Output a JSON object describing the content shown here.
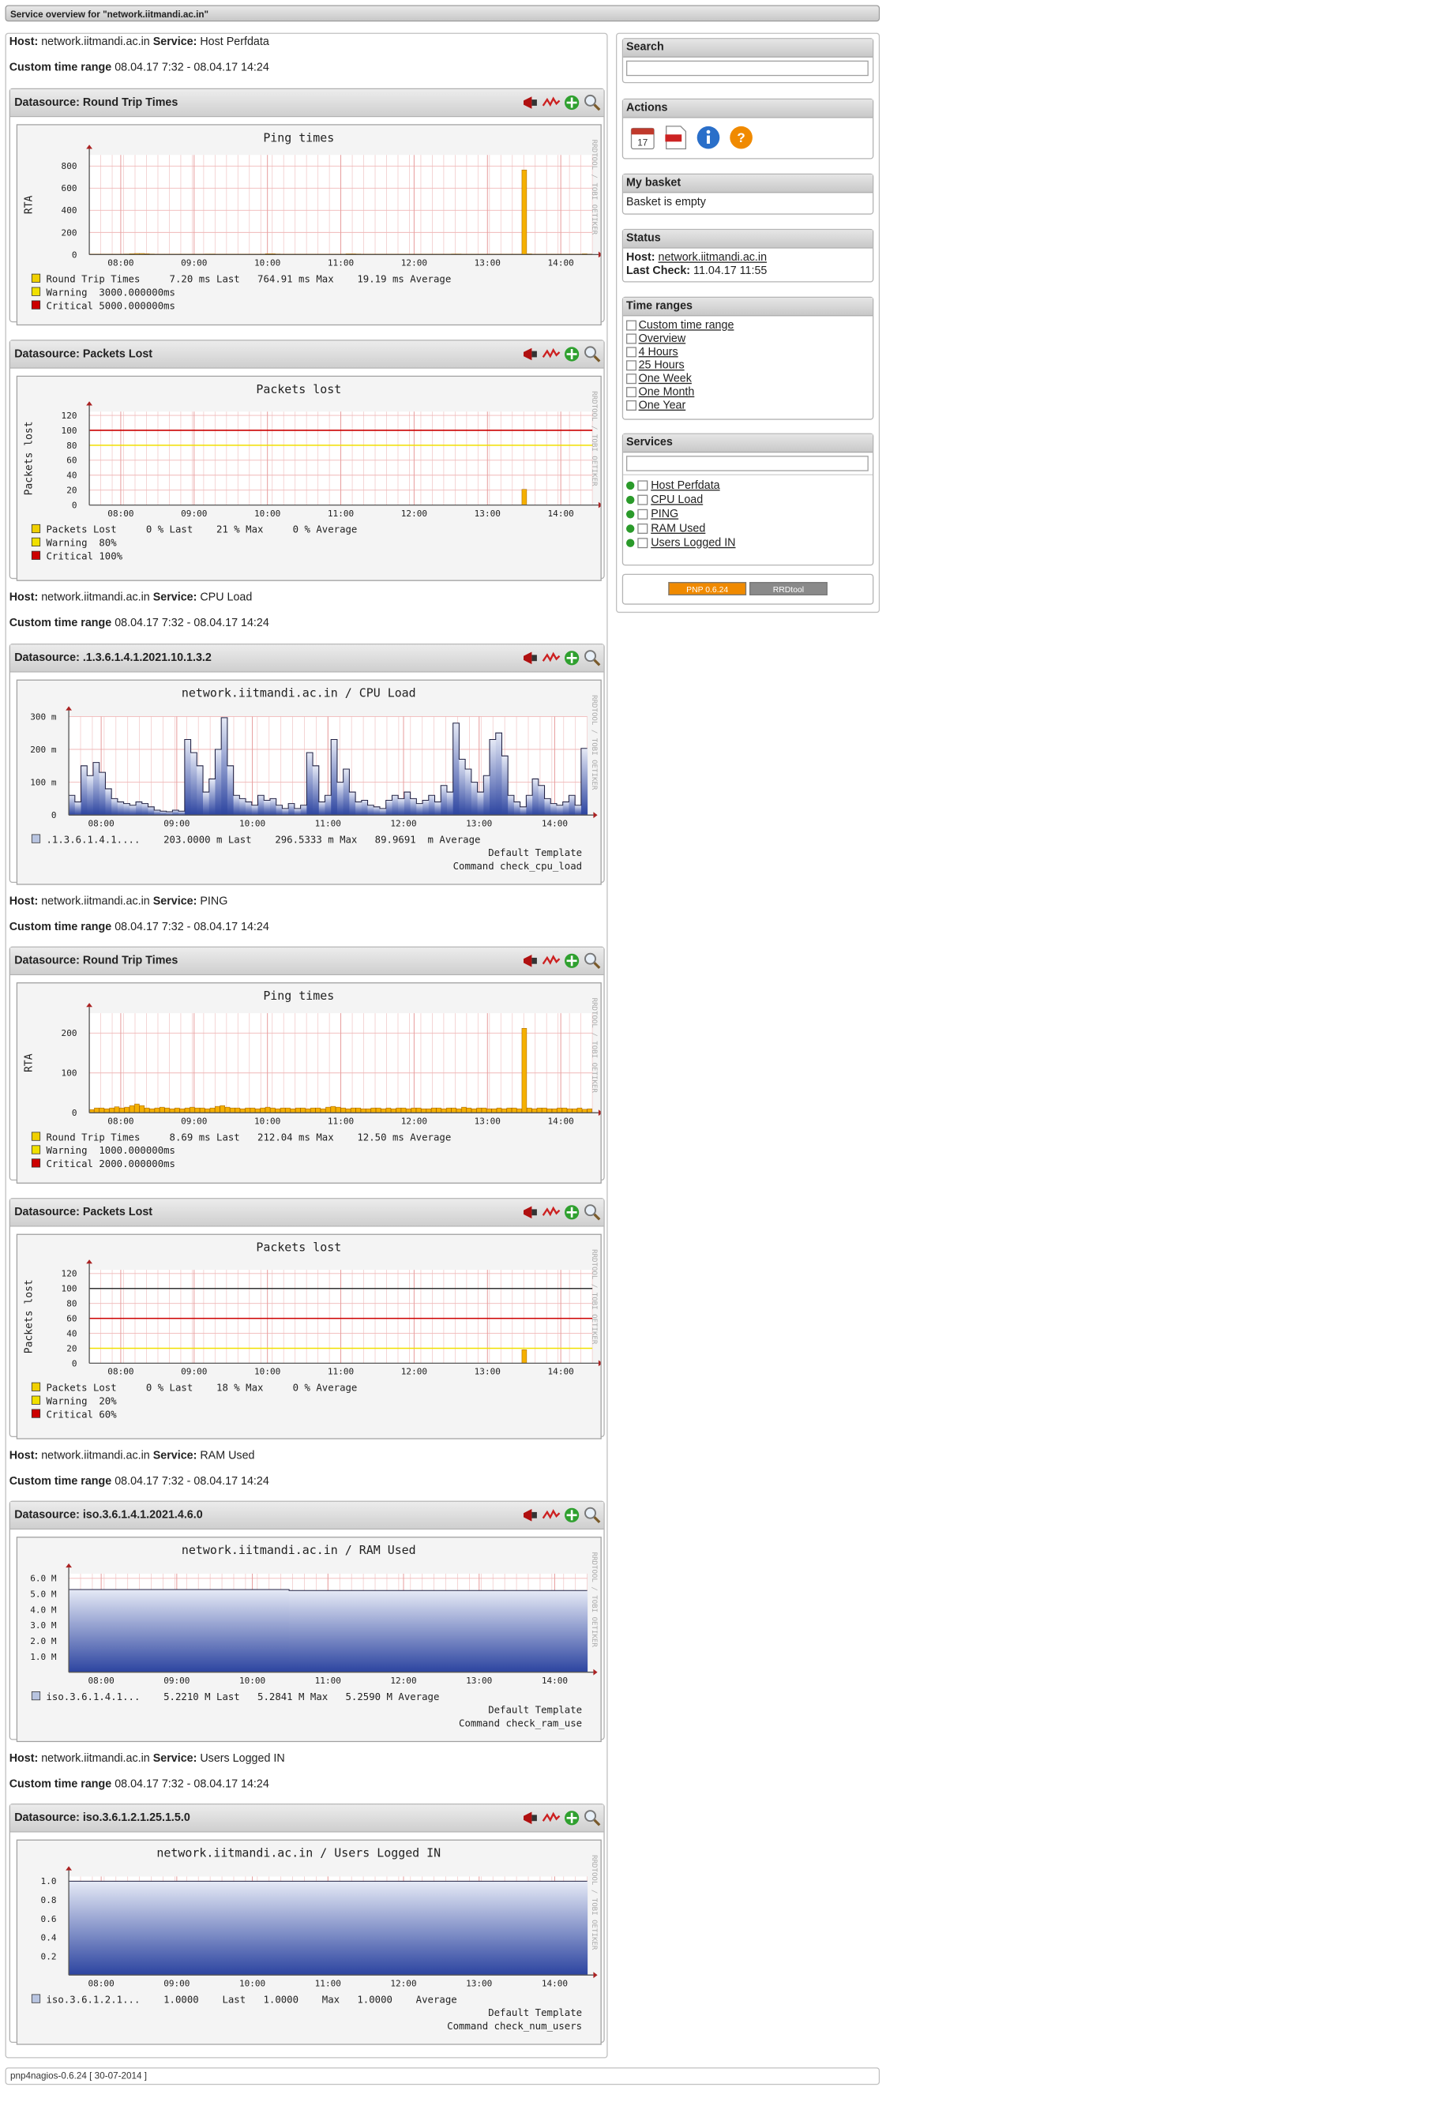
{
  "header": {
    "title": "Service overview for \"network.iitmandi.ac.in\""
  },
  "footer": {
    "version": "pnp4nagios-0.6.24 [ 30-07-2014 ]"
  },
  "labels": {
    "host": "Host:",
    "service": "Service:",
    "custom_time_range": "Custom time range",
    "datasource": "Datasource:"
  },
  "host": "network.iitmandi.ac.in",
  "time_range": "08.04.17 7:32 - 08.04.17 14:24",
  "x_ticks": [
    "08:00",
    "09:00",
    "10:00",
    "11:00",
    "12:00",
    "13:00",
    "14:00"
  ],
  "watermark": "RRDTOOL / TOBI OETIKER",
  "services": [
    {
      "id": "s1",
      "name": "Host Perfdata"
    },
    {
      "id": "s2",
      "name": "CPU Load"
    },
    {
      "id": "s3",
      "name": "PING"
    },
    {
      "id": "s4",
      "name": "RAM Used"
    },
    {
      "id": "s5",
      "name": "Users Logged IN"
    }
  ],
  "graphs": [
    {
      "id": "g1",
      "datasource": "Round Trip Times",
      "title": "Ping times",
      "ylabel": "RTA",
      "y_ticks": [
        "800",
        "600",
        "400",
        "200",
        "0"
      ],
      "ymax": 900,
      "thresholds": [],
      "legend": [
        {
          "text": "Round Trip Times     7.20 ms Last   764.91 ms Max    19.19 ms Average",
          "color": "#f0d000"
        },
        {
          "text": "Warning  3000.000000ms",
          "color": "#f0e000"
        },
        {
          "text": "Critical 5000.000000ms",
          "color": "#cc0000"
        }
      ],
      "extra": []
    },
    {
      "id": "g2",
      "datasource": "Packets Lost",
      "title": "Packets lost",
      "ylabel": "Packets lost",
      "y_ticks": [
        "120",
        "100",
        "80",
        "60",
        "40",
        "20",
        "0"
      ],
      "ymax": 125,
      "thresholds": [
        {
          "value": 100,
          "color": "#cc0000"
        },
        {
          "value": 80,
          "color": "#f0e000"
        }
      ],
      "legend": [
        {
          "text": "Packets Lost     0 % Last    21 % Max     0 % Average",
          "color": "#f0d000"
        },
        {
          "text": "Warning  80%",
          "color": "#f0e000"
        },
        {
          "text": "Critical 100%",
          "color": "#cc0000"
        }
      ],
      "extra": []
    },
    {
      "id": "g3",
      "datasource": ".1.3.6.1.4.1.2021.10.1.3.2",
      "title": "network.iitmandi.ac.in / CPU Load",
      "ylabel": "",
      "y_ticks": [
        "300 m",
        "200 m",
        "100 m",
        "0"
      ],
      "ymax": 300,
      "thresholds": [],
      "legend": [
        {
          "text": ".1.3.6.1.4.1....    203.0000 m Last    296.5333 m Max   89.9691  m Average",
          "color": "#b8c4e0"
        }
      ],
      "extra": [
        "Default Template",
        "Command check_cpu_load"
      ]
    },
    {
      "id": "g4",
      "datasource": "Round Trip Times",
      "title": "Ping times",
      "ylabel": "RTA",
      "y_ticks": [
        "200",
        "100",
        "0"
      ],
      "ymax": 250,
      "thresholds": [],
      "legend": [
        {
          "text": "Round Trip Times     8.69 ms Last   212.04 ms Max    12.50 ms Average",
          "color": "#f0d000"
        },
        {
          "text": "Warning  1000.000000ms",
          "color": "#f0e000"
        },
        {
          "text": "Critical 2000.000000ms",
          "color": "#cc0000"
        }
      ],
      "extra": []
    },
    {
      "id": "g5",
      "datasource": "Packets Lost",
      "title": "Packets lost",
      "ylabel": "Packets lost",
      "y_ticks": [
        "120",
        "100",
        "80",
        "60",
        "40",
        "20",
        "0"
      ],
      "ymax": 125,
      "thresholds": [
        {
          "value": 100,
          "color": "#333333"
        },
        {
          "value": 60,
          "color": "#cc0000"
        },
        {
          "value": 20,
          "color": "#f0e000"
        }
      ],
      "legend": [
        {
          "text": "Packets Lost     0 % Last    18 % Max     0 % Average",
          "color": "#f0d000"
        },
        {
          "text": "Warning  20%",
          "color": "#f0e000"
        },
        {
          "text": "Critical 60%",
          "color": "#cc0000"
        }
      ],
      "extra": []
    },
    {
      "id": "g6",
      "datasource": "iso.3.6.1.4.1.2021.4.6.0",
      "title": "network.iitmandi.ac.in / RAM Used",
      "ylabel": "",
      "y_ticks": [
        "6.0 M",
        "5.0 M",
        "4.0 M",
        "3.0 M",
        "2.0 M",
        "1.0 M"
      ],
      "ymax": 6.3,
      "thresholds": [],
      "legend": [
        {
          "text": "iso.3.6.1.4.1...    5.2210 M Last   5.2841 M Max   5.2590 M Average",
          "color": "#b8c4e0"
        }
      ],
      "extra": [
        "Default Template",
        "Command check_ram_use"
      ]
    },
    {
      "id": "g7",
      "datasource": "iso.3.6.1.2.1.25.1.5.0",
      "title": "network.iitmandi.ac.in / Users Logged IN",
      "ylabel": "",
      "y_ticks": [
        "1.0",
        "0.8",
        "0.6",
        "0.4",
        "0.2"
      ],
      "ymax": 1.05,
      "thresholds": [],
      "legend": [
        {
          "text": "iso.3.6.1.2.1...    1.0000    Last   1.0000    Max   1.0000    Average",
          "color": "#b8c4e0"
        }
      ],
      "extra": [
        "Default Template",
        "Command check_num_users"
      ]
    }
  ],
  "chart_data": [
    {
      "type": "bar",
      "title": "Ping times",
      "ylabel": "RTA",
      "ylim": [
        0,
        900
      ],
      "series": [
        {
          "name": "Round Trip Times",
          "values": [
            5,
            5,
            5,
            5,
            5,
            5,
            5,
            6,
            8,
            10,
            10,
            8,
            6,
            5,
            5,
            5,
            5,
            5,
            5,
            5,
            5,
            5,
            5,
            6,
            6,
            5,
            5,
            5,
            5,
            5,
            5,
            5,
            5,
            5,
            5,
            8,
            8,
            6,
            5,
            5,
            5,
            5,
            5,
            5,
            5,
            5,
            5,
            5,
            5,
            5,
            5,
            7,
            7,
            6,
            5,
            5,
            5,
            5,
            5,
            5,
            5,
            5,
            5,
            5,
            5,
            5,
            5,
            5,
            5,
            5,
            5,
            5,
            6,
            6,
            5,
            5,
            5,
            5,
            5,
            5,
            5,
            5,
            5,
            5,
            5,
            5,
            764.91,
            7,
            5,
            5,
            5,
            5,
            5,
            5,
            5,
            5,
            5,
            5,
            7.2,
            5
          ]
        }
      ]
    },
    {
      "type": "bar",
      "title": "Packets lost",
      "ylabel": "Packets lost",
      "ylim": [
        0,
        125
      ],
      "series": [
        {
          "name": "Packets Lost",
          "values": [
            0,
            0,
            0,
            0,
            0,
            0,
            0,
            0,
            0,
            0,
            0,
            0,
            0,
            0,
            0,
            0,
            0,
            0,
            0,
            0,
            0,
            0,
            0,
            0,
            0,
            0,
            0,
            0,
            0,
            0,
            0,
            0,
            0,
            0,
            0,
            0,
            0,
            0,
            0,
            0,
            0,
            0,
            0,
            0,
            0,
            0,
            0,
            0,
            0,
            0,
            0,
            0,
            0,
            0,
            0,
            0,
            0,
            0,
            0,
            0,
            0,
            0,
            0,
            0,
            0,
            0,
            0,
            0,
            0,
            0,
            0,
            0,
            0,
            0,
            0,
            0,
            0,
            0,
            0,
            0,
            0,
            0,
            0,
            0,
            0,
            0,
            21,
            0,
            0,
            0,
            0,
            0,
            0,
            0,
            0,
            0,
            0,
            0,
            0,
            0
          ]
        }
      ]
    },
    {
      "type": "area",
      "title": "network.iitmandi.ac.in / CPU Load",
      "ylim": [
        0,
        300
      ],
      "series": [
        {
          "name": ".1.3.6.1.4.1....",
          "values": [
            60,
            40,
            150,
            120,
            160,
            130,
            80,
            50,
            40,
            35,
            30,
            40,
            35,
            25,
            15,
            12,
            10,
            15,
            12,
            230,
            190,
            150,
            70,
            110,
            200,
            296.5333,
            150,
            60,
            50,
            40,
            30,
            60,
            45,
            50,
            30,
            20,
            35,
            20,
            30,
            190,
            150,
            40,
            60,
            230,
            100,
            140,
            70,
            40,
            45,
            30,
            25,
            20,
            45,
            60,
            50,
            70,
            50,
            35,
            45,
            60,
            40,
            90,
            70,
            280,
            170,
            140,
            100,
            70,
            120,
            230,
            250,
            180,
            60,
            40,
            25,
            60,
            110,
            90,
            50,
            35,
            30,
            40,
            60,
            30,
            203
          ]
        }
      ]
    },
    {
      "type": "bar",
      "title": "Ping times",
      "ylabel": "RTA",
      "ylim": [
        0,
        250
      ],
      "series": [
        {
          "name": "Round Trip Times",
          "values": [
            8,
            12,
            12,
            10,
            12,
            15,
            12,
            14,
            18,
            22,
            18,
            12,
            10,
            12,
            14,
            12,
            10,
            12,
            10,
            12,
            14,
            12,
            12,
            10,
            12,
            16,
            18,
            14,
            12,
            12,
            10,
            12,
            12,
            10,
            12,
            14,
            12,
            10,
            12,
            12,
            10,
            12,
            12,
            10,
            12,
            12,
            10,
            14,
            16,
            14,
            12,
            10,
            12,
            12,
            10,
            10,
            12,
            12,
            10,
            12,
            10,
            12,
            12,
            10,
            12,
            12,
            10,
            10,
            12,
            12,
            10,
            12,
            12,
            10,
            14,
            12,
            10,
            12,
            12,
            10,
            10,
            12,
            10,
            12,
            12,
            10,
            212.04,
            12,
            10,
            12,
            12,
            10,
            10,
            12,
            12,
            10,
            10,
            12,
            8.69,
            10
          ]
        }
      ]
    },
    {
      "type": "bar",
      "title": "Packets lost",
      "ylabel": "Packets lost",
      "ylim": [
        0,
        125
      ],
      "series": [
        {
          "name": "Packets Lost",
          "values": [
            0,
            0,
            0,
            0,
            0,
            0,
            0,
            0,
            0,
            0,
            0,
            0,
            0,
            0,
            0,
            0,
            0,
            0,
            0,
            0,
            0,
            0,
            0,
            0,
            0,
            0,
            0,
            0,
            0,
            0,
            0,
            0,
            0,
            0,
            0,
            0,
            0,
            0,
            0,
            0,
            0,
            0,
            0,
            0,
            0,
            0,
            0,
            0,
            0,
            0,
            0,
            0,
            0,
            0,
            0,
            0,
            0,
            0,
            0,
            0,
            0,
            0,
            0,
            0,
            0,
            0,
            0,
            0,
            0,
            0,
            0,
            0,
            0,
            0,
            0,
            0,
            0,
            0,
            0,
            0,
            0,
            0,
            0,
            0,
            0,
            0,
            18,
            0,
            0,
            0,
            0,
            0,
            0,
            0,
            0,
            0,
            0,
            0,
            0,
            0
          ]
        }
      ]
    },
    {
      "type": "area",
      "title": "network.iitmandi.ac.in / RAM Used",
      "ylim": [
        0,
        6.3
      ],
      "series": [
        {
          "name": "iso.3.6.1.4.1...",
          "values": [
            5.2841,
            5.2841,
            5.2841,
            5.2841,
            5.2841,
            5.2841,
            5.2841,
            5.2841,
            5.2841,
            5.2841,
            5.2841,
            5.2841,
            5.2841,
            5.2841,
            5.2841,
            5.2841,
            5.2841,
            5.2841,
            5.2841,
            5.2841,
            5.2841,
            5.2841,
            5.2841,
            5.2841,
            5.2841,
            5.2841,
            5.2841,
            5.2841,
            5.2841,
            5.2841,
            5.2841,
            5.2841,
            5.2841,
            5.2841,
            5.221,
            5.221,
            5.221,
            5.221,
            5.221,
            5.221,
            5.221,
            5.221,
            5.221,
            5.221,
            5.221,
            5.221,
            5.221,
            5.221,
            5.221,
            5.221,
            5.221,
            5.221,
            5.221,
            5.221,
            5.221,
            5.221,
            5.221,
            5.221,
            5.221,
            5.221,
            5.221,
            5.221,
            5.221,
            5.221,
            5.221,
            5.221,
            5.221,
            5.221,
            5.221,
            5.221,
            5.221,
            5.221,
            5.221,
            5.221,
            5.221,
            5.221,
            5.221,
            5.221,
            5.221,
            5.221
          ]
        }
      ]
    },
    {
      "type": "area",
      "title": "network.iitmandi.ac.in / Users Logged IN",
      "ylim": [
        0,
        1.05
      ],
      "series": [
        {
          "name": "iso.3.6.1.2.1...",
          "values": [
            1,
            1,
            1,
            1,
            1,
            1,
            1,
            1,
            1,
            1,
            1,
            1,
            1,
            1,
            1,
            1,
            1,
            1,
            1,
            1,
            1,
            1,
            1,
            1,
            1,
            1,
            1,
            1,
            1,
            1,
            1,
            1,
            1,
            1,
            1,
            1,
            1,
            1,
            1,
            1,
            1,
            1,
            1,
            1,
            1,
            1,
            1,
            1,
            1,
            1,
            1,
            1,
            1,
            1,
            1,
            1,
            1,
            1,
            1,
            1,
            1,
            1,
            1,
            1,
            1,
            1,
            1,
            1,
            1,
            1,
            1,
            1,
            1,
            1,
            1,
            1,
            1,
            1,
            1,
            1
          ]
        }
      ]
    }
  ],
  "sidebar": {
    "search": {
      "title": "Search",
      "placeholder": ""
    },
    "actions": {
      "title": "Actions",
      "items": [
        {
          "name": "calendar-icon",
          "color": "#c0392b"
        },
        {
          "name": "pdf-icon",
          "color": "#cc2222"
        },
        {
          "name": "info-icon",
          "color": "#2a6fc9"
        },
        {
          "name": "help-icon",
          "color": "#f08a00"
        }
      ]
    },
    "basket": {
      "title": "My basket",
      "text": "Basket is empty"
    },
    "status": {
      "title": "Status",
      "host_label": "Host:",
      "host": "network.iitmandi.ac.in",
      "last_check_label": "Last Check:",
      "last_check": "11.04.17 11:55"
    },
    "time_ranges": {
      "title": "Time ranges",
      "items": [
        "Custom time range",
        "Overview",
        "4 Hours",
        "25 Hours",
        "One Week",
        "One Month",
        "One Year"
      ]
    },
    "services": {
      "title": "Services",
      "filter_placeholder": ""
    },
    "badges": {
      "pnp": "PNP 0.6.24",
      "rrd": "RRDtool"
    }
  }
}
